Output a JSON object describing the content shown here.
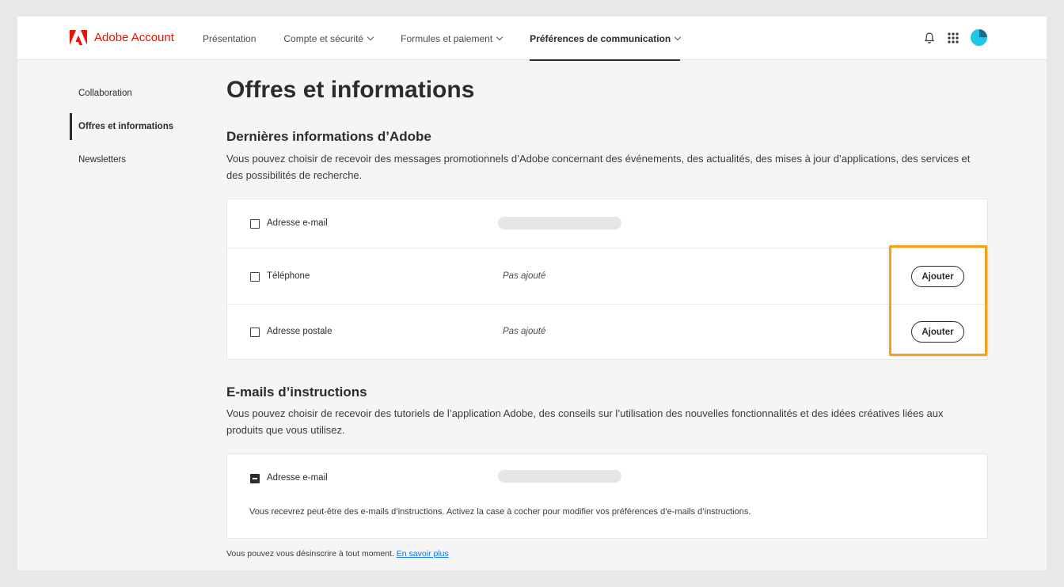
{
  "header": {
    "brand": "Adobe Account",
    "nav": [
      {
        "label": "Présentation",
        "dropdown": false
      },
      {
        "label": "Compte et sécurité",
        "dropdown": true
      },
      {
        "label": "Formules et paiement",
        "dropdown": true
      },
      {
        "label": "Préférences de communication",
        "dropdown": true,
        "active": true
      }
    ],
    "icons": [
      "bell-icon",
      "apps-grid-icon",
      "avatar"
    ]
  },
  "sidebar": {
    "items": [
      {
        "label": "Collaboration"
      },
      {
        "label": "Offres et informations",
        "active": true
      },
      {
        "label": "Newsletters"
      }
    ]
  },
  "main": {
    "title": "Offres et informations",
    "latest": {
      "title": "Dernières informations d’Adobe",
      "description": "Vous pouvez choisir de recevoir des messages promotionnels d’Adobe concernant des événements, des actualités, des mises à jour d’applications, des services et des possibilités de recherche.",
      "rows": [
        {
          "label": "Adresse e-mail",
          "value_redacted": true
        },
        {
          "label": "Téléphone",
          "status": "Pas ajouté",
          "button": "Ajouter"
        },
        {
          "label": "Adresse postale",
          "status": "Pas ajouté",
          "button": "Ajouter"
        }
      ]
    },
    "instructions": {
      "title": "E-mails d’instructions",
      "description": "Vous pouvez choisir de recevoir des tutoriels de l’application Adobe, des conseils sur l’utilisation des nouvelles fonctionnalités et des idées créatives liées aux produits que vous utilisez.",
      "row_label": "Adresse e-mail",
      "note": "Vous recevrez peut-être des e-mails d’instructions. Activez la case à cocher pour modifier vos préférences d’e-mails d’instructions."
    },
    "footer_text": "Vous pouvez vous désinscrire à tout moment.",
    "footer_link": "En savoir plus"
  },
  "colors": {
    "brand": "#eb1000",
    "highlight": "#f59f1b",
    "link": "#1473e6",
    "avatar": "#1ec6e8"
  }
}
